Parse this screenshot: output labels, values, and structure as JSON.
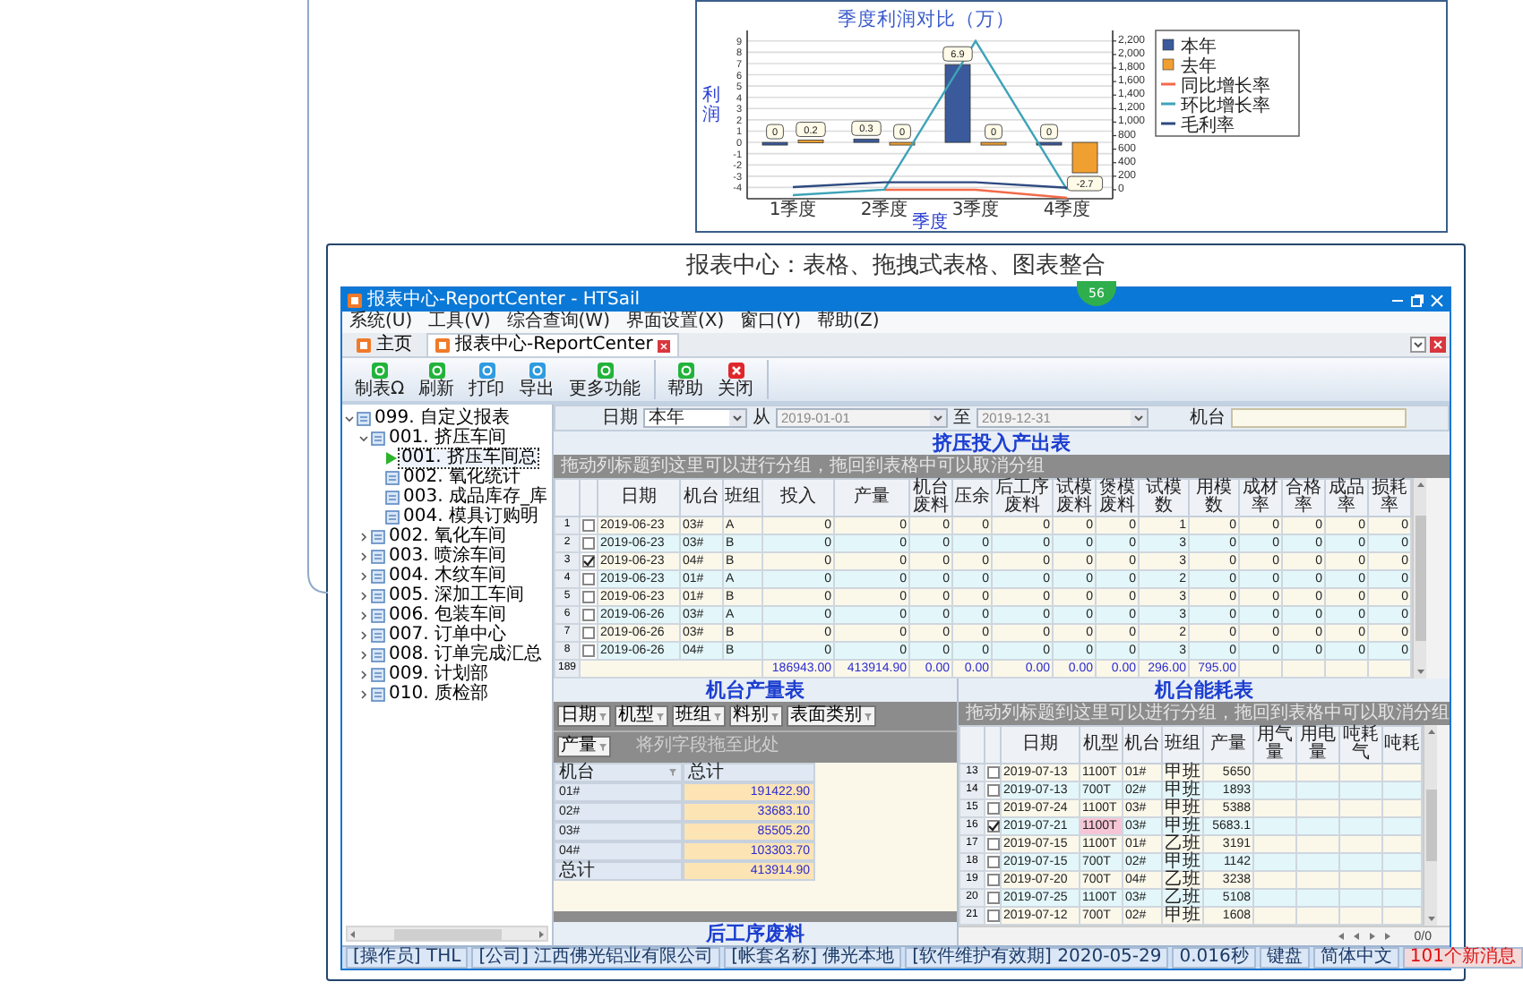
{
  "chart_panel": {
    "chart_data": {
      "type": "bar",
      "title": "季度利润对比（万）",
      "xlabel": "季度",
      "ylabel": "利润",
      "categories": [
        "1季度",
        "2季度",
        "3季度",
        "4季度"
      ],
      "series": [
        {
          "name": "本年",
          "type": "bar",
          "color": "#3a5a9c",
          "values": [
            0,
            0.3,
            6.9,
            0
          ],
          "value_labels": [
            "0",
            "0.3",
            "6.9",
            "0"
          ]
        },
        {
          "name": "去年",
          "type": "bar",
          "color": "#f0a030",
          "values": [
            0.2,
            0,
            0,
            -2.7
          ],
          "value_labels": [
            "0.2",
            "0",
            "0",
            "-2.7"
          ]
        },
        {
          "name": "同比增长率",
          "type": "line",
          "axis": "y2",
          "color": "#f26a4a",
          "values": [
            null,
            0,
            0,
            -120
          ],
          "value_labels": [
            null,
            null,
            null,
            null
          ]
        },
        {
          "name": "环比增长率",
          "type": "line",
          "axis": "y2",
          "color": "#3ea3b8",
          "values": [
            -80,
            0,
            2200,
            0
          ],
          "value_labels": [
            null,
            null,
            null,
            null
          ]
        },
        {
          "name": "毛利率",
          "type": "line",
          "axis": "y2",
          "color": "#2d4a80",
          "values": [
            40,
            110,
            110,
            30
          ],
          "value_labels": [
            null,
            null,
            null,
            null
          ]
        }
      ],
      "grid": true,
      "legend": "right",
      "ylim": [
        -5,
        9.3
      ],
      "y2lim": [
        -133,
        2250
      ],
      "yticks": [
        -4,
        -3,
        -2,
        -1,
        0,
        1,
        2,
        3,
        4,
        5,
        6,
        7,
        8,
        9
      ],
      "y2ticks": [
        0,
        200,
        400,
        600,
        800,
        {
          "value": 1000,
          "label": "1,000"
        },
        {
          "value": 1200,
          "label": "1,200"
        },
        {
          "value": 1400,
          "label": "1,400"
        },
        {
          "value": 1600,
          "label": "1,600"
        },
        {
          "value": 1800,
          "label": "1,800"
        },
        {
          "value": 2000,
          "label": "2,000"
        },
        {
          "value": 2200,
          "label": "2,200"
        }
      ],
      "stacked": false
    }
  },
  "banner_title": "报表中心：表格、拖拽式表格、图表整合",
  "window": {
    "title": "报表中心-ReportCenter - HTSail",
    "badge": "56"
  },
  "menu": [
    "系统(U)",
    "工具(V)",
    "综合查询(W)",
    "界面设置(X)",
    "窗口(Y)",
    "帮助(Z)"
  ],
  "doc_tabs": [
    {
      "label": "主页",
      "selected": false
    },
    {
      "label": "报表中心-ReportCenter",
      "selected": true
    }
  ],
  "toolbar": [
    [
      {
        "label": "制表Ω",
        "kind": "action",
        "color": "#22b33a"
      },
      {
        "label": "刷新",
        "kind": "action",
        "color": "#22b33a"
      },
      {
        "label": "打印",
        "kind": "action",
        "color": "#2f9be0"
      },
      {
        "label": "导出",
        "kind": "action",
        "color": "#2f9be0"
      },
      {
        "label": "更多功能",
        "kind": "action",
        "color": "#22b33a"
      }
    ],
    [
      {
        "label": "帮助",
        "kind": "action",
        "color": "#22b33a"
      },
      {
        "label": "关闭",
        "kind": "close",
        "color": "#e0262a"
      }
    ]
  ],
  "tree": [
    {
      "label": "099. 自定义报表",
      "expanded": true,
      "selected": false,
      "children": [
        {
          "label": "001. 挤压车间",
          "expanded": true,
          "selected": false,
          "children": [
            {
              "label": "001. 挤压车间总",
              "selected": true
            },
            {
              "label": "002. 氧化统计",
              "selected": false
            },
            {
              "label": "003. 成品库存_库",
              "selected": false
            },
            {
              "label": "004. 模具订购明",
              "selected": false
            }
          ]
        },
        {
          "label": "002. 氧化车间",
          "expanded": false,
          "selected": false
        },
        {
          "label": "003. 喷涂车间",
          "expanded": false,
          "selected": false
        },
        {
          "label": "004. 木纹车间",
          "expanded": false,
          "selected": false
        },
        {
          "label": "005. 深加工车间",
          "expanded": false,
          "selected": false
        },
        {
          "label": "006. 包装车间",
          "expanded": false,
          "selected": false
        },
        {
          "label": "007. 订单中心",
          "expanded": false,
          "selected": false
        },
        {
          "label": "008. 订单完成汇总",
          "expanded": false,
          "selected": false
        },
        {
          "label": "009. 计划部",
          "expanded": false,
          "selected": false
        },
        {
          "label": "010. 质检部",
          "expanded": false,
          "selected": false
        }
      ]
    }
  ],
  "filters": {
    "date_label": "日期",
    "period": "本年",
    "from_label": "从",
    "from": "2019-01-01",
    "to_label": "至",
    "to": "2019-12-31",
    "machine_label": "机台"
  },
  "main_table": {
    "title": "挤压投入产出表",
    "group_hint": "拖动列标题到这里可以进行分组，拖回到表格中可以取消分组",
    "columns": [
      "日期",
      "机台",
      "班组",
      "投入",
      "产量",
      "机台废料",
      "压余",
      "后工序废料",
      "试模废料",
      "煲模废料",
      "试模数",
      "用模数",
      "成材率",
      "合格率",
      "成品率",
      "损耗率"
    ],
    "rows": [
      {
        "no": "1",
        "checked": false,
        "cells": [
          "2019-06-23",
          "03#",
          "A",
          "0",
          "0",
          "0",
          "0",
          "0",
          "0",
          "0",
          "1",
          "0",
          "0",
          "0",
          "0",
          "0"
        ]
      },
      {
        "no": "2",
        "checked": false,
        "cells": [
          "2019-06-23",
          "03#",
          "B",
          "0",
          "0",
          "0",
          "0",
          "0",
          "0",
          "0",
          "3",
          "0",
          "0",
          "0",
          "0",
          "0"
        ]
      },
      {
        "no": "3",
        "checked": true,
        "cells": [
          "2019-06-23",
          "04#",
          "B",
          "0",
          "0",
          "0",
          "0",
          "0",
          "0",
          "0",
          "3",
          "0",
          "0",
          "0",
          "0",
          "0"
        ]
      },
      {
        "no": "4",
        "checked": false,
        "cells": [
          "2019-06-23",
          "01#",
          "A",
          "0",
          "0",
          "0",
          "0",
          "0",
          "0",
          "0",
          "2",
          "0",
          "0",
          "0",
          "0",
          "0"
        ]
      },
      {
        "no": "5",
        "checked": false,
        "cells": [
          "2019-06-23",
          "01#",
          "B",
          "0",
          "0",
          "0",
          "0",
          "0",
          "0",
          "0",
          "3",
          "0",
          "0",
          "0",
          "0",
          "0"
        ]
      },
      {
        "no": "6",
        "checked": false,
        "cells": [
          "2019-06-26",
          "03#",
          "A",
          "0",
          "0",
          "0",
          "0",
          "0",
          "0",
          "0",
          "3",
          "0",
          "0",
          "0",
          "0",
          "0"
        ]
      },
      {
        "no": "7",
        "checked": false,
        "cells": [
          "2019-06-26",
          "03#",
          "B",
          "0",
          "0",
          "0",
          "0",
          "0",
          "0",
          "0",
          "2",
          "0",
          "0",
          "0",
          "0",
          "0"
        ]
      },
      {
        "no": "8",
        "checked": false,
        "cells": [
          "2019-06-26",
          "04#",
          "B",
          "0",
          "0",
          "0",
          "0",
          "0",
          "0",
          "0",
          "3",
          "0",
          "0",
          "0",
          "0",
          "0"
        ]
      }
    ],
    "footer": {
      "count": "189",
      "totals": [
        "186943.00",
        "413914.90",
        "0.00",
        "0.00",
        "0.00",
        "0.00",
        "0.00",
        "296.00",
        "795.00"
      ]
    }
  },
  "pivot": {
    "title": "机台产量表",
    "filter_fields": [
      "日期",
      "机型",
      "班组",
      "料别",
      "表面类别"
    ],
    "data_field": "产量",
    "column_hint": "将列字段拖至此处",
    "row_field": "机台",
    "total_header": "总计",
    "rows": [
      {
        "label": "01#",
        "value": "191422.90"
      },
      {
        "label": "02#",
        "value": "33683.10"
      },
      {
        "label": "03#",
        "value": "85505.20"
      },
      {
        "label": "04#",
        "value": "103303.70"
      },
      {
        "label": "总计",
        "value": "413914.90"
      }
    ],
    "next_title": "后工序废料"
  },
  "energy_table": {
    "title": "机台能耗表",
    "group_hint": "拖动列标题到这里可以进行分组，拖回到表格中可以取消分组",
    "columns": [
      "日期",
      "机型",
      "机台",
      "班组",
      "产量",
      "用气量",
      "用电量",
      "吨耗气",
      "吨耗"
    ],
    "rows": [
      {
        "no": "13",
        "checked": false,
        "focused": false,
        "cells": [
          "2019-07-13",
          "1100T",
          "01#",
          "甲班",
          "5650"
        ]
      },
      {
        "no": "14",
        "checked": false,
        "focused": false,
        "cells": [
          "2019-07-13",
          "700T",
          "02#",
          "甲班",
          "1893"
        ]
      },
      {
        "no": "15",
        "checked": false,
        "focused": false,
        "cells": [
          "2019-07-24",
          "1100T",
          "03#",
          "甲班",
          "5388"
        ]
      },
      {
        "no": "16",
        "checked": true,
        "focused": true,
        "cells": [
          "2019-07-21",
          "1100T",
          "03#",
          "甲班",
          "5683.1"
        ]
      },
      {
        "no": "17",
        "checked": false,
        "focused": false,
        "cells": [
          "2019-07-15",
          "1100T",
          "01#",
          "乙班",
          "3191"
        ]
      },
      {
        "no": "18",
        "checked": false,
        "focused": false,
        "cells": [
          "2019-07-15",
          "700T",
          "02#",
          "甲班",
          "1142"
        ]
      },
      {
        "no": "19",
        "checked": false,
        "focused": false,
        "cells": [
          "2019-07-20",
          "700T",
          "04#",
          "乙班",
          "3238"
        ]
      },
      {
        "no": "20",
        "checked": false,
        "focused": false,
        "cells": [
          "2019-07-25",
          "1100T",
          "03#",
          "乙班",
          "5108"
        ]
      },
      {
        "no": "21",
        "checked": false,
        "focused": false,
        "cells": [
          "2019-07-12",
          "700T",
          "02#",
          "甲班",
          "1608"
        ]
      }
    ],
    "pager": "0/0"
  },
  "status_bar": [
    {
      "text": "[操作员] THL",
      "alert": false
    },
    {
      "text": "[公司] 江西佛光铝业有限公司",
      "alert": false
    },
    {
      "text": "[帐套名称] 佛光本地",
      "alert": false
    },
    {
      "text": "[软件维护有效期] 2020-05-29",
      "alert": false
    },
    {
      "text": "0.016秒",
      "alert": false
    },
    {
      "text": "键盘",
      "alert": false
    },
    {
      "text": "简体中文",
      "alert": false
    },
    {
      "text": "101个新消息",
      "alert": true
    }
  ]
}
